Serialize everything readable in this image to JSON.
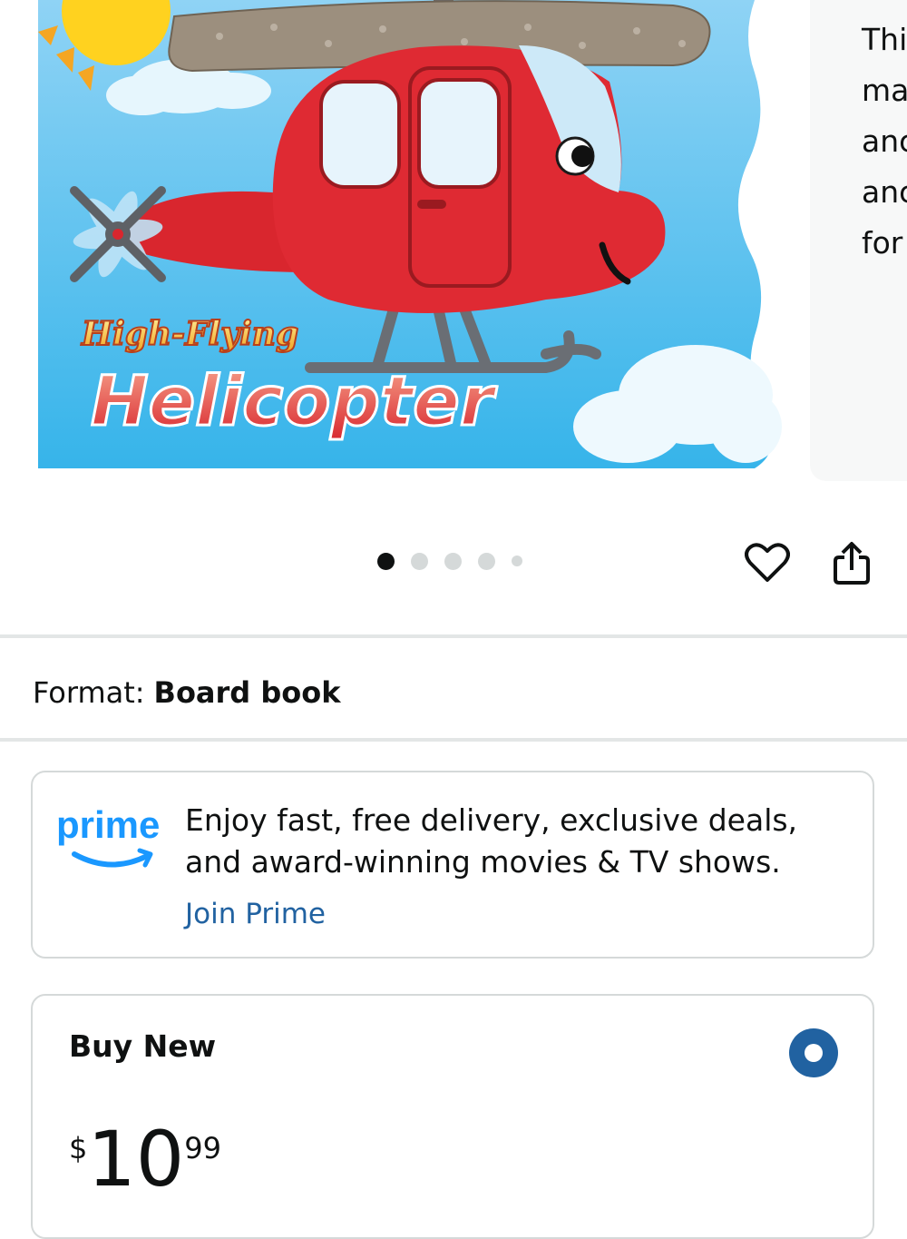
{
  "gallery": {
    "cover_title_line1": "High-Flying",
    "cover_title_line2": "Helicopter",
    "side_text_lines": [
      "Thi",
      "ma",
      "anc",
      "anc",
      "for"
    ],
    "dots": {
      "count": 5,
      "active_index": 0
    },
    "wishlist_icon": "heart-outline-icon",
    "share_icon": "share-icon"
  },
  "format": {
    "label": "Format:",
    "value": "Board book"
  },
  "prime": {
    "logo_text": "prime",
    "line1": "Enjoy fast, free delivery, exclusive deals,",
    "line2": "and award-winning movies & TV shows.",
    "cta": "Join Prime",
    "brand_color": "#1a98ff",
    "link_color": "#2162a1"
  },
  "buy_new": {
    "title": "Buy New",
    "currency": "$",
    "price_whole": "10",
    "price_fraction": "99",
    "selected": true
  }
}
